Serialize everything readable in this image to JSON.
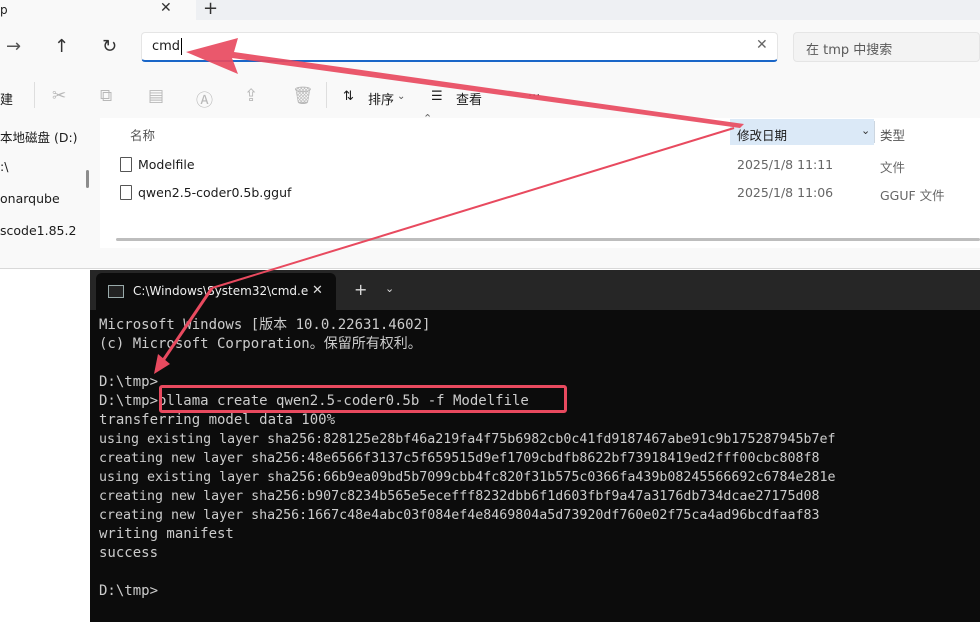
{
  "explorer": {
    "tab_title": "p",
    "tab_close": "✕",
    "tab_new": "+",
    "nav": {
      "back": "←",
      "forward": "→",
      "up": "↑",
      "refresh": "↻"
    },
    "address": {
      "value": "cmd",
      "clear": "✕"
    },
    "search": {
      "placeholder": "在 tmp 中搜索"
    },
    "toolbar": {
      "new_partial": "建",
      "sort_label": "排序",
      "view_label": "查看",
      "more_label": "···"
    },
    "sidebar": {
      "items": [
        "本地磁盘 (D:)",
        ":\\",
        "onarqube",
        "scode1.85.2"
      ]
    },
    "columns": {
      "name": "名称",
      "date": "修改日期",
      "type": "类型"
    },
    "files": [
      {
        "name": "Modelfile",
        "date": "2025/1/8 11:11",
        "type": "文件"
      },
      {
        "name": "qwen2.5-coder0.5b.gguf",
        "date": "2025/1/8 11:06",
        "type": "GGUF 文件"
      }
    ]
  },
  "terminal": {
    "tab_title": "C:\\Windows\\System32\\cmd.e",
    "tab_close": "✕",
    "new_tab": "+",
    "dropdown": "⌄",
    "lines": [
      "Microsoft Windows [版本 10.0.22631.4602]",
      "(c) Microsoft Corporation。保留所有权利。",
      "",
      "D:\\tmp>",
      "D:\\tmp>ollama create qwen2.5-coder0.5b -f Modelfile",
      "transferring model data 100%",
      "using existing layer sha256:828125e28bf46a219fa4f75b6982cb0c41fd9187467abe91c9b175287945b7ef",
      "creating new layer sha256:48e6566f3137c5f659515d9ef1709cbdfb8622bf73918419ed2fff00cbc808f8",
      "using existing layer sha256:66b9ea09bd5b7099cbb4fc820f31b575c0366fa439b08245566692c6784e281e",
      "creating new layer sha256:b907c8234b565e5ecefff8232dbb6f1d603fbf9a47a3176db734dcae27175d08",
      "creating new layer sha256:1667c48e4abc03f084ef4e8469804a5d73920df760e02f75ca4ad96bcdfaaf83",
      "writing manifest",
      "success",
      "",
      "D:\\tmp>"
    ]
  },
  "colors": {
    "annotation": "#e84a5f",
    "accent": "#1a66c8",
    "terminal_bg": "#0c0c0c",
    "terminal_text": "#cccccc"
  }
}
